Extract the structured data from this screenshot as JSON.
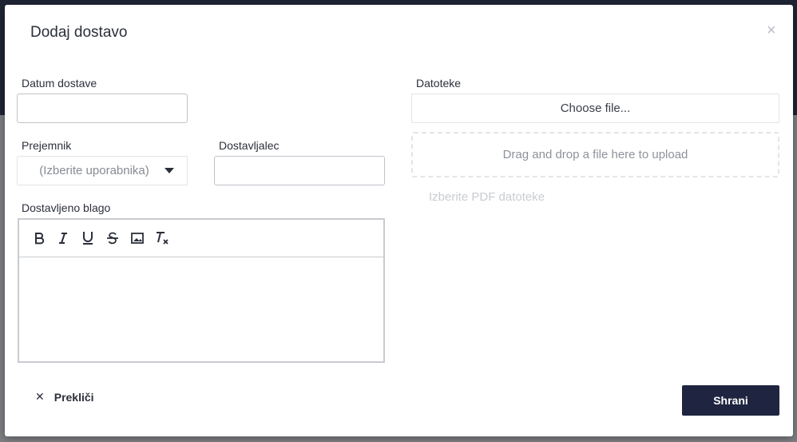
{
  "modal": {
    "title": "Dodaj dostavo",
    "close_icon": "close-icon"
  },
  "form": {
    "delivery_date": {
      "label": "Datum dostave",
      "value": ""
    },
    "recipient": {
      "label": "Prejemnik",
      "selected": "(Izberite uporabnika)"
    },
    "deliverer": {
      "label": "Dostavljalec",
      "value": ""
    },
    "goods": {
      "label": "Dostavljeno blago",
      "toolbar": [
        "bold-icon",
        "italic-icon",
        "underline-icon",
        "strikethrough-icon",
        "image-icon",
        "clear-format-icon"
      ]
    },
    "files": {
      "label": "Datoteke",
      "choose_button": "Choose file...",
      "dropzone_text": "Drag and drop a file here to upload",
      "hint": "Izberite PDF datoteke"
    }
  },
  "footer": {
    "cancel_label": "Prekliči",
    "save_label": "Shrani"
  },
  "colors": {
    "primary_button": "#1f2540",
    "overlay": "#6e6f75"
  }
}
